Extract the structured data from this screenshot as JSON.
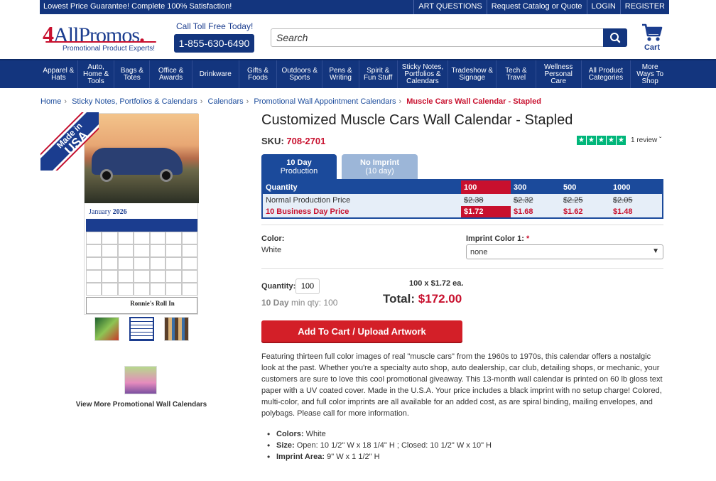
{
  "topbar": {
    "promo": "Lowest Price Guarantee!  Complete 100% Satisfaction!",
    "links": [
      "ART QUESTIONS",
      "Request Catalog or Quote",
      "LOGIN",
      "REGISTER"
    ]
  },
  "header": {
    "logo_four": "4",
    "logo_text": "AllPromos",
    "logo_dot": ".",
    "logo_tag": "Promotional Product Experts!",
    "toll_free": "Call Toll Free Today!",
    "phone": "1-855-630-6490",
    "search_placeholder": "Search",
    "cart_label": "Cart"
  },
  "nav": [
    "Apparel & Hats",
    "Auto, Home & Tools",
    "Bags & Totes",
    "Office & Awards",
    "Drinkware",
    "Gifts & Foods",
    "Outdoors & Sports",
    "Pens & Writing",
    "Spirit & Fun Stuff",
    "Sticky Notes, Portfolios & Calendars",
    "Tradeshow & Signage",
    "Tech & Travel",
    "Wellness Personal Care",
    "All Product Categories",
    "More Ways To Shop"
  ],
  "breadcrumb": [
    "Home",
    "Sticky Notes, Portfolios & Calendars",
    "Calendars",
    "Promotional Wall Appointment Calendars",
    "Muscle Cars Wall Calendar - Stapled"
  ],
  "gallery": {
    "badge_line1": "Made in",
    "badge_line2": "USA",
    "cal_month": "January",
    "cal_year": "2026",
    "cal_ad": "Ronnie's Roll In",
    "more_link": "View More Promotional Wall Calendars"
  },
  "product": {
    "title": "Customized Muscle Cars Wall Calendar - Stapled",
    "sku_label": "SKU:",
    "sku": "708-2701",
    "rating_stars": 5,
    "reviews": "1 review ˇ",
    "tab1_title": "10 Day",
    "tab1_sub": "Production",
    "tab2_title": "No Imprint",
    "tab2_sub": "(10 day)"
  },
  "pricing": {
    "qty_label": "Quantity",
    "quantities": [
      "100",
      "300",
      "500",
      "1000"
    ],
    "normal_label": "Normal Production Price",
    "normal_prices": [
      "$2.38",
      "$2.32",
      "$2.25",
      "$2.05"
    ],
    "biz_label": "10 Business Day Price",
    "biz_prices": [
      "$1.72",
      "$1.68",
      "$1.62",
      "$1.48"
    ]
  },
  "options": {
    "color_label": "Color:",
    "color_value": "White",
    "imprint_label": "Imprint Color 1:",
    "imprint_req": "*",
    "imprint_value": "none"
  },
  "order": {
    "qty_label": "Quantity:",
    "qty_value": "100",
    "min_day": "10 Day",
    "min_qty": "min qty: 100",
    "each": "100 x $1.72 ea.",
    "total_label": "Total:",
    "total_value": "$172.00",
    "add_to_cart": "Add To Cart / Upload Artwork"
  },
  "description": "Featuring thirteen full color images of real \"muscle cars\" from the 1960s to 1970s, this calendar offers a nostalgic look at the past. Whether you're a specialty auto shop, auto dealership, car club, detailing shops, or mechanic, your customers are sure to love this cool promotional giveaway. This 13-month wall calendar is printed on 60 lb gloss text paper with a UV coated cover. Made in the U.S.A. Your price includes a black imprint with no setup charge! Colored, multi-color, and full color imprints are all available for an added cost, as are spiral binding, mailing envelopes, and polybags. Please call for more information.",
  "specs": [
    {
      "label": "Colors:",
      "value": "White"
    },
    {
      "label": "Size:",
      "value": "Open: 10 1/2\" W x 18 1/4\" H ; Closed: 10 1/2\" W x 10\" H"
    },
    {
      "label": "Imprint Area:",
      "value": "9\" W x 1 1/2\" H"
    }
  ],
  "colors": {
    "brand_navy": "#13357e",
    "accent_red": "#c8102e",
    "trustpilot_green": "#00b67a"
  }
}
